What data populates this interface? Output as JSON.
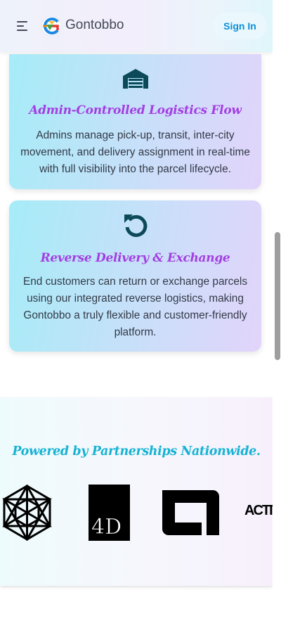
{
  "header": {
    "brand": "Gontobbo",
    "signin_label": "Sign In"
  },
  "features": [
    {
      "icon": "warehouse-icon",
      "title": "Admin-Controlled Logistics Flow",
      "text": "Admins manage pick-up, transit, inter-city movement, and delivery assignment in real-time with full visibility into the parcel lifecycle."
    },
    {
      "icon": "rotate-ccw-icon",
      "title": "Reverse Delivery & Exchange",
      "text": "End customers can return or exchange parcels using our integrated reverse logistics, making Gontobbo a truly flexible and customer-friendly platform."
    }
  ],
  "partners": {
    "title": "Powered by Partnerships Nationwide.",
    "logos": [
      {
        "icon": "metatron-cube-logo"
      },
      {
        "icon": "4d-logo",
        "text": "4D"
      },
      {
        "icon": "abbott-logo"
      },
      {
        "icon": "activision-logo",
        "text": "ACTIV"
      }
    ]
  },
  "colors": {
    "accent_purple": "#a43ee3",
    "accent_cyan": "#16b3d3",
    "signin_text": "#0b8fd6",
    "icon_dark_teal": "#0c4a5a"
  }
}
